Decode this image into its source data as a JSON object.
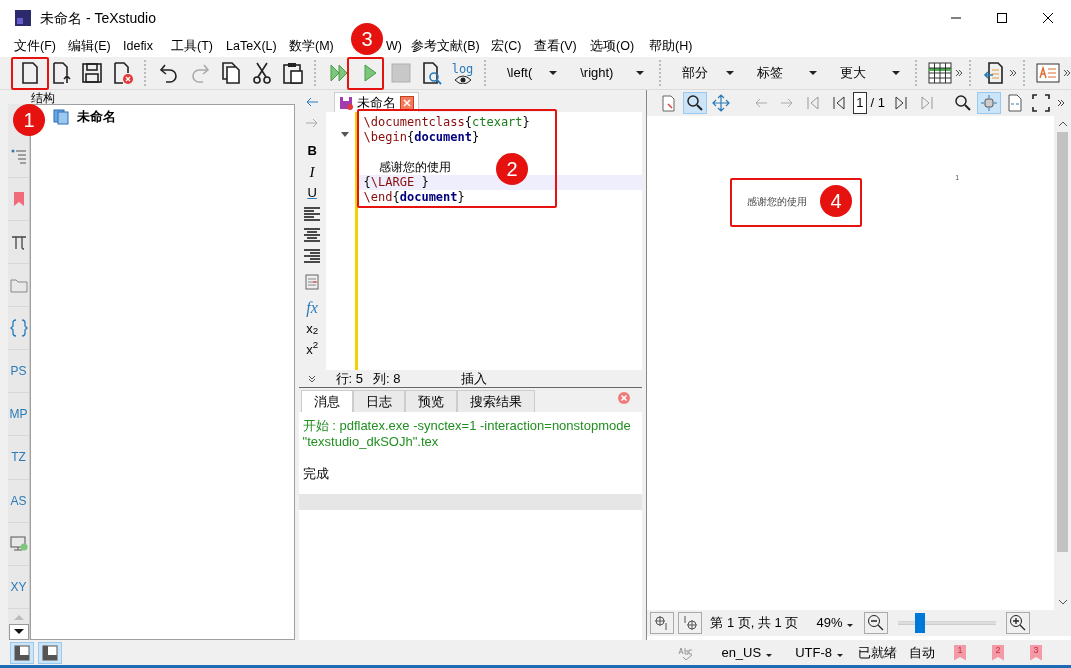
{
  "window": {
    "title": "未命名 - TeXstudio"
  },
  "menu": [
    "文件(F)",
    "编辑(E)",
    "Idefix",
    "工具(T)",
    "LaTeX(L)",
    "数学(M)",
    "W)",
    "参考文献(B)",
    "宏(C)",
    "查看(V)",
    "选项(O)",
    "帮助(H)"
  ],
  "toolbar": {
    "log_label": "log",
    "dropdowns": [
      "\\left(",
      "\\right)",
      "部分",
      "标签",
      "更大"
    ]
  },
  "side_labels": [
    "PS",
    "MP",
    "TZ",
    "AS",
    "XY"
  ],
  "structure": {
    "title": "结构",
    "items": [
      {
        "label": "未命名"
      }
    ]
  },
  "format_toolbar": [
    "B",
    "I",
    "U",
    "fx",
    "x$_{2}$",
    "x$^{2}$"
  ],
  "editor": {
    "tab": "未命名",
    "lines": [
      {
        "current": false,
        "segments": [
          {
            "kind": "command",
            "text": "\\documentclass"
          },
          {
            "kind": "brace",
            "text": "{"
          },
          {
            "kind": "argument",
            "text": "ctexart"
          },
          {
            "kind": "brace",
            "text": "}"
          }
        ]
      },
      {
        "current": false,
        "segments": [
          {
            "kind": "command",
            "text": "\\begin"
          },
          {
            "kind": "brace",
            "text": "{"
          },
          {
            "kind": "environment",
            "text": "document"
          },
          {
            "kind": "brace",
            "text": "}"
          }
        ]
      },
      {
        "current": false
      },
      {
        "current": false,
        "segments": [
          {
            "kind": "text",
            "text": "    感谢您的使用"
          }
        ]
      },
      {
        "current": true,
        "segments": [
          {
            "kind": "brace",
            "text": "{"
          },
          {
            "kind": "command",
            "text": "\\LARGE "
          },
          {
            "kind": "brace",
            "text": "}"
          }
        ]
      },
      {
        "current": false,
        "segments": [
          {
            "kind": "command",
            "text": "\\end"
          },
          {
            "kind": "brace",
            "text": "{"
          },
          {
            "kind": "environment",
            "text": "document"
          },
          {
            "kind": "brace",
            "text": "}"
          }
        ]
      }
    ]
  },
  "cursor_status": {
    "line_label": "行:",
    "line": "5",
    "col_label": "列:",
    "col": "8",
    "mode": "插入"
  },
  "messages": {
    "tabs": [
      {
        "label": "消息",
        "selected": true
      },
      {
        "label": "日志",
        "selected": false
      },
      {
        "label": "预览",
        "selected": false
      },
      {
        "label": "搜索结果",
        "selected": false
      }
    ],
    "lines": [
      {
        "kind": "command",
        "text": "开始 : pdflatex.exe -synctex=1 -interaction=nonstopmode \"texstudio_dkSOJh\".tex"
      },
      {
        "kind": "plain",
        "text": "完成"
      }
    ]
  },
  "pdf": {
    "tools": [
      {
        "kind": "sync",
        "selected": false
      },
      {
        "kind": "zoom",
        "selected": true
      },
      {
        "kind": "pan",
        "selected": false
      }
    ],
    "view_tools": [
      {
        "kind": "find",
        "selected": false
      },
      {
        "kind": "fit-width",
        "selected": true
      },
      {
        "kind": "fit-page",
        "selected": false
      },
      {
        "kind": "fullscreen",
        "selected": false
      }
    ],
    "page_number": "1",
    "page_total": "/ 1",
    "page_label": "1",
    "content": "感谢您的使用",
    "page_info": "第 1 页, 共 1 页",
    "zoom": "49%",
    "zoom_slider": {
      "level": 0.22
    }
  },
  "status": {
    "language": "en_US",
    "encoding": "UTF-8",
    "state": "已就绪",
    "mode": "自动",
    "bookmarks": [
      "1",
      "2",
      "3"
    ]
  },
  "annotations": [
    {
      "label": "1"
    },
    {
      "label": "2"
    },
    {
      "label": "3"
    },
    {
      "label": "4"
    }
  ]
}
